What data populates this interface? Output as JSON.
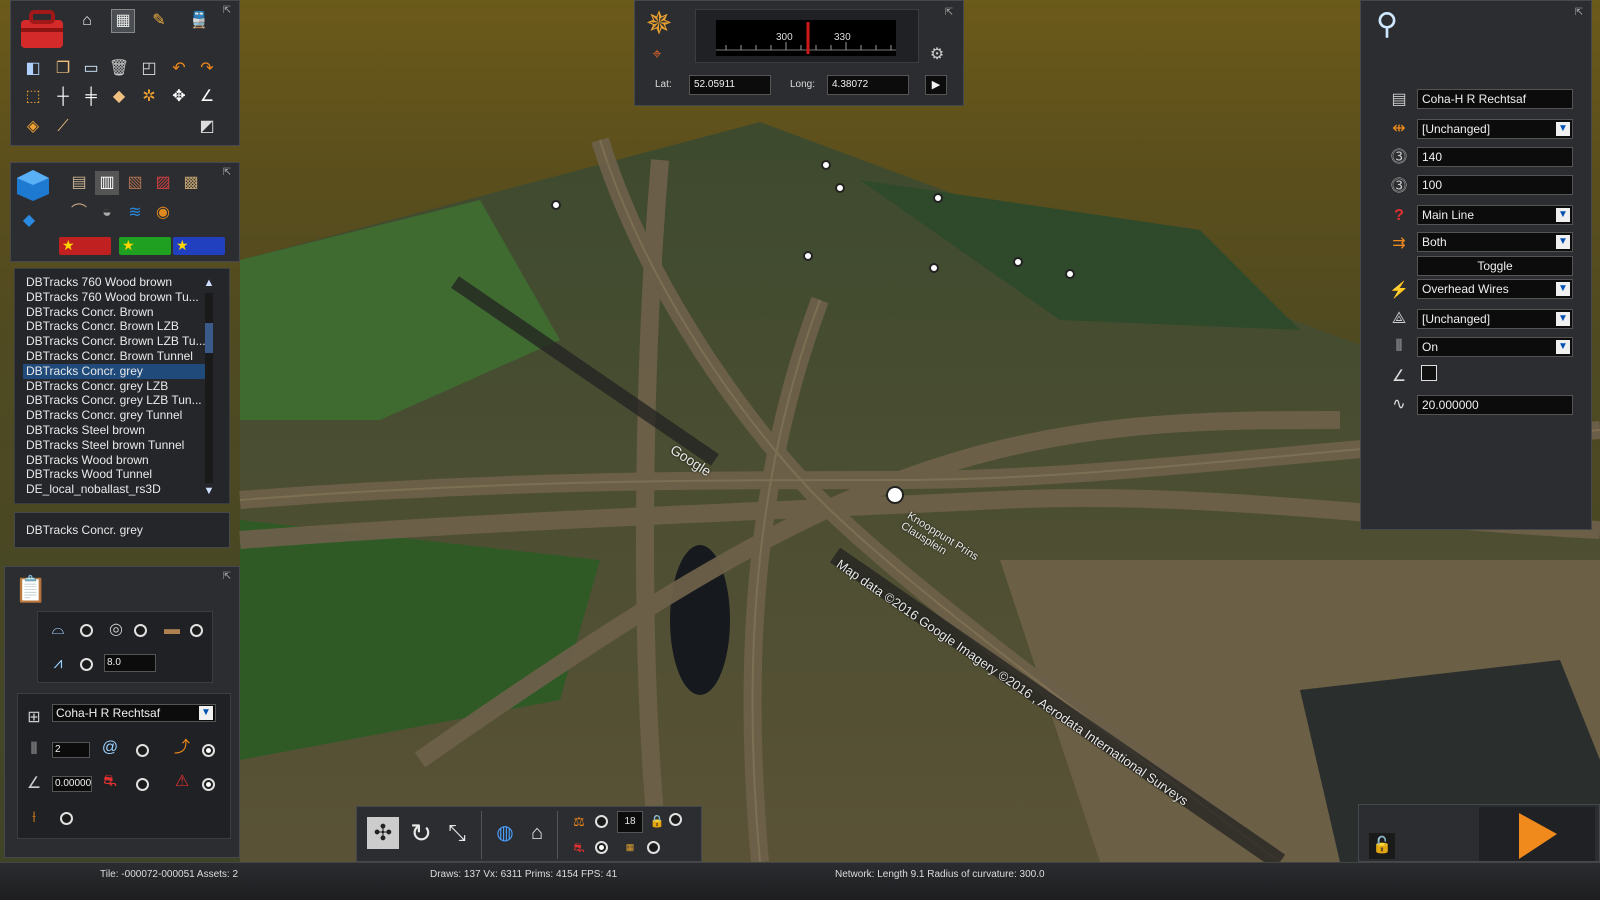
{
  "compass": {
    "heading_ticks": [
      "300",
      "330"
    ],
    "lat_label": "Lat:",
    "lat_value": "52.05911",
    "long_label": "Long:",
    "long_value": "4.38072"
  },
  "track_list": {
    "items": [
      "DBTracks 760 Wood brown",
      "DBTracks 760 Wood brown Tu...",
      "DBTracks Concr. Brown",
      "DBTracks Concr. Brown LZB",
      "DBTracks Concr. Brown LZB Tu...",
      "DBTracks Concr. Brown Tunnel",
      "DBTracks Concr. grey",
      "DBTracks Concr. grey LZB",
      "DBTracks Concr. grey LZB Tun...",
      "DBTracks Concr. grey Tunnel",
      "DBTracks Steel brown",
      "DBTracks Steel brown Tunnel",
      "DBTracks Wood brown",
      "DBTracks Wood Tunnel",
      "DE_local_noballast_rs3D"
    ],
    "selected_index": 6,
    "selected_name": "DBTracks Concr. grey"
  },
  "track_options": {
    "height_value": "8.0",
    "rule_select": "Coha-H R Rechtsaf",
    "track_count": "2",
    "angle_value": "0.00000"
  },
  "properties": {
    "name_value": "Coha-H R Rechtsaf",
    "rule_select": "[Unchanged]",
    "speed_limit_1": "140",
    "speed_limit_2": "100",
    "track_type": "Main Line",
    "direction": "Both",
    "toggle_label": "Toggle",
    "electrification": "Overhead Wires",
    "select_5": "[Unchanged]",
    "select_6": "On",
    "curve_value": "20.000000"
  },
  "bottom_toolbar": {
    "counter": "18"
  },
  "map_overlay": {
    "google_mark": "Google",
    "junction_name": "Knooppunt Prins Clausplein",
    "copyright": "Map data ©2016 Google  Imagery ©2016 , Aerodata International Surveys"
  },
  "status": {
    "tile": "Tile: -000072-000051  Assets: 2",
    "stats": "Draws: 137 Vx: 6311 Prims: 4154 FPS: 41",
    "network": "Network:  Length    9.1 Radius of curvature: 300.0"
  },
  "colors": {
    "selected_item": "#1f4a7a",
    "accent_orange": "#f08a1c",
    "panel_bg": "#2b2d30"
  }
}
